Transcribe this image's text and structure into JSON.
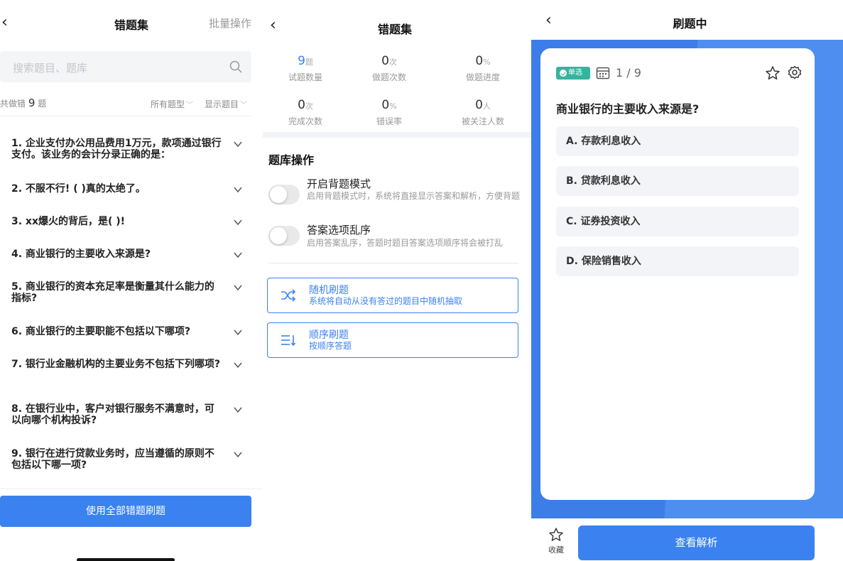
{
  "screen1": {
    "back_icon": "‹",
    "title": "错题集",
    "batch_label": "批量操作",
    "search_placeholder": "搜索题目、题库",
    "count_prefix": "共做错",
    "count_value": "9",
    "count_suffix": "题",
    "filter_type": "所有题型",
    "filter_show": "显示题目",
    "questions": [
      "1. 企业支付办公用品费用1万元，款项通过银行支付。该业务的会计分录正确的是：",
      "2. 不服不行! ( )真的太绝了。",
      "3. xx爆火的背后，是( )!",
      "4. 商业银行的主要收入来源是?",
      "5. 商业银行的资本充足率是衡量其什么能力的指标?",
      "6. 商业银行的主要职能不包括以下哪项?",
      "7. 银行业金融机构的主要业务不包括下列哪项?",
      "8. 在银行业中，客户对银行服务不满意时，可以向哪个机构投诉?",
      "9. 银行在进行贷款业务时，应当遵循的原则不包括以下哪一项?"
    ],
    "bottom_button": "使用全部错题刷题"
  },
  "screen2": {
    "back_icon": "‹",
    "title": "错题集",
    "stats": [
      {
        "value": "9",
        "unit": "题",
        "label": "试题数量"
      },
      {
        "value": "0",
        "unit": "次",
        "label": "做题次数"
      },
      {
        "value": "0",
        "unit": "%",
        "label": "做题进度"
      },
      {
        "value": "0",
        "unit": "次",
        "label": "完成次数"
      },
      {
        "value": "0",
        "unit": "%",
        "label": "错误率"
      },
      {
        "value": "0",
        "unit": "人",
        "label": "被关注人数"
      }
    ],
    "section_title": "题库操作",
    "option1_title": "开启背题模式",
    "option1_desc": "启用背题模式时，系统将直接显示答案和解析，方便背题",
    "option1_on": false,
    "option2_title": "答案选项乱序",
    "option2_desc": "启用答案乱序，答题时题目答案选项顺序将会被打乱",
    "option2_on": false,
    "mode1_title": "随机刷题",
    "mode1_desc": "系统将自动从没有答过的题目中随机抽取",
    "mode2_title": "顺序刷题",
    "mode2_desc": "按顺序答题"
  },
  "screen3": {
    "back_icon": "‹",
    "title": "刷题中",
    "tag_label": "单选",
    "question_index": "1 / 9",
    "question": "商业银行的主要收入来源是?",
    "choices": [
      "A. 存款利息收入",
      "B. 贷款利息收入",
      "C. 证券投资收入",
      "D. 保险销售收入"
    ],
    "favorite_label": "收藏",
    "view_button": "查看解析"
  },
  "colors": {
    "accent": "#3b82f0",
    "tag_green": "#36b3a0",
    "background_blue": "#3c7de8"
  }
}
